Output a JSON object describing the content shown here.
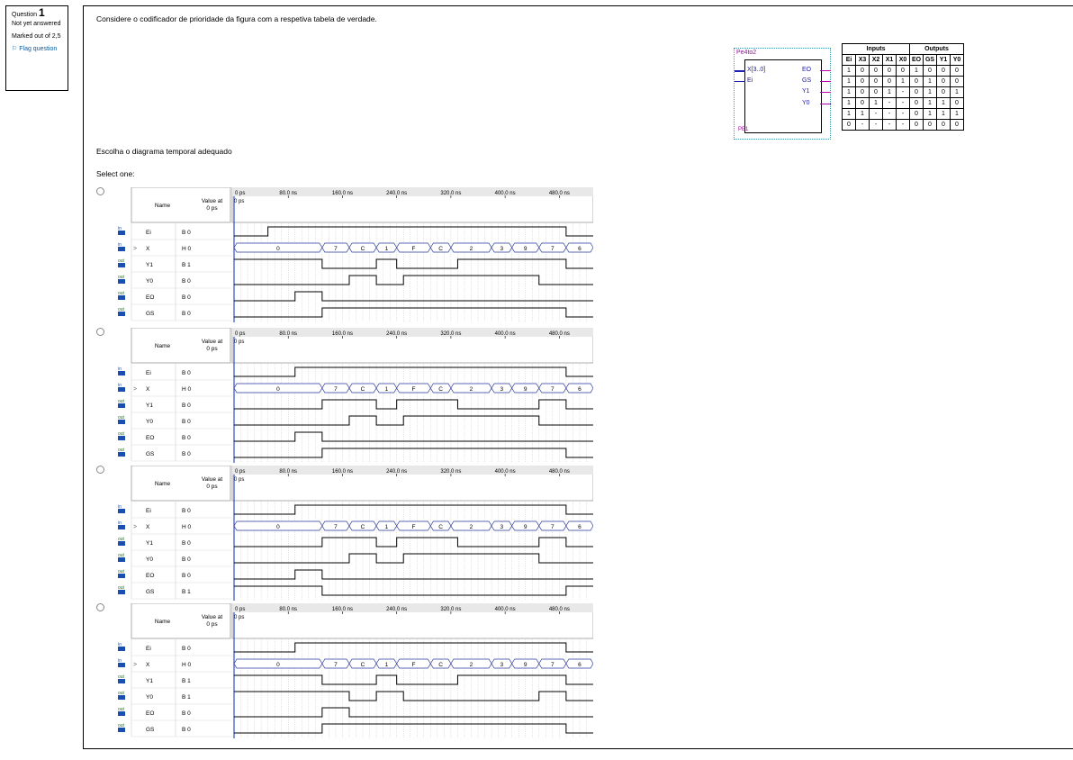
{
  "question_info": {
    "label": "Question",
    "number": "1",
    "status": "Not yet answered",
    "marked": "Marked out of 2,5",
    "flag": "Flag question"
  },
  "question": {
    "text": "Considere o codificador de prioridade da figura com a respetiva tabela de verdade.",
    "prompt": "Escolha o diagrama temporal adequado",
    "select_label": "Select one:"
  },
  "symbol": {
    "name": "Pe4to2",
    "inputs": [
      "X[3..0]",
      "Ei"
    ],
    "outputs": [
      "EO",
      "GS",
      "Y1",
      "Y0"
    ],
    "instance": "PE1"
  },
  "truth_table": {
    "group_inputs": "Inputs",
    "group_outputs": "Outputs",
    "headers": [
      "Ei",
      "X3",
      "X2",
      "X1",
      "X0",
      "EO",
      "GS",
      "Y1",
      "Y0"
    ],
    "rows": [
      [
        "1",
        "0",
        "0",
        "0",
        "0",
        "1",
        "0",
        "0",
        "0"
      ],
      [
        "1",
        "0",
        "0",
        "0",
        "1",
        "0",
        "1",
        "0",
        "0"
      ],
      [
        "1",
        "0",
        "0",
        "1",
        "-",
        "0",
        "1",
        "0",
        "1"
      ],
      [
        "1",
        "0",
        "1",
        "-",
        "-",
        "0",
        "1",
        "1",
        "0"
      ],
      [
        "1",
        "1",
        "-",
        "-",
        "-",
        "0",
        "1",
        "1",
        "1"
      ],
      [
        "0",
        "-",
        "-",
        "-",
        "-",
        "0",
        "0",
        "0",
        "0"
      ]
    ]
  },
  "waveform_common": {
    "name_header": "Name",
    "value_header": "Value at\n0 ps",
    "time_labels": [
      "0 ps",
      "80.0 ns",
      "160.0 ns",
      "240.0 ns",
      "320.0 ns",
      "400.0 ns",
      "480.0 ns"
    ],
    "cursor_label": "0 ps",
    "signal_names": [
      "Ei",
      "X",
      "Y1",
      "Y0",
      "EO",
      "GS"
    ],
    "signal_dirs": [
      "in",
      "in",
      "out",
      "out",
      "out",
      "out"
    ],
    "x_bus_values": [
      "0",
      "7",
      "C",
      "1",
      "F",
      "C",
      "2",
      "3",
      "9",
      "7",
      "6"
    ]
  },
  "options": [
    {
      "values": [
        "B 0",
        "H 0",
        "B 1",
        "B 0",
        "B 0",
        "B 0"
      ]
    },
    {
      "values": [
        "B 0",
        "H 0",
        "B 0",
        "B 0",
        "B 0",
        "B 0"
      ]
    },
    {
      "values": [
        "B 0",
        "H 0",
        "B 0",
        "B 0",
        "B 0",
        "B 1"
      ]
    },
    {
      "values": [
        "B 0",
        "H 0",
        "B 1",
        "B 1",
        "B 0",
        "B 0"
      ]
    }
  ]
}
